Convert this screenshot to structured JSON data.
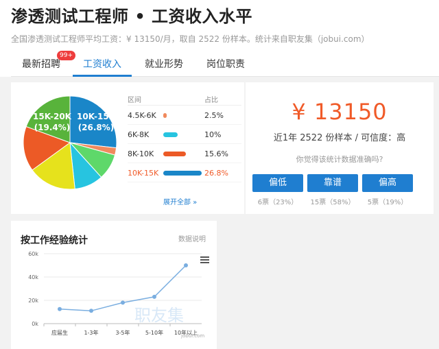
{
  "header": {
    "title": "渗透测试工程师 • 工资收入水平",
    "subtitle": "全国渗透测试工程师平均工资：¥ 13150/月，取自 2522 份样本。统计来自职友集（jobui.com）"
  },
  "tabs": [
    {
      "label": "最新招聘",
      "badge": "99+"
    },
    {
      "label": "工资收入",
      "active": true
    },
    {
      "label": "就业形势"
    },
    {
      "label": "岗位职责"
    }
  ],
  "distribution": {
    "col_range": "区间",
    "col_share": "占比",
    "rows": [
      {
        "label": "4.5K-6K",
        "percent": 2.5,
        "percent_text": "2.5%",
        "color": "#f08a5d"
      },
      {
        "label": "6K-8K",
        "percent": 10,
        "percent_text": "10%",
        "color": "#27c4e0"
      },
      {
        "label": "8K-10K",
        "percent": 15.6,
        "percent_text": "15.6%",
        "color": "#ec5a26"
      },
      {
        "label": "10K-15K",
        "percent": 26.8,
        "percent_text": "26.8%",
        "color": "#1a86c8",
        "highlight": true
      }
    ],
    "expand_label": "展开全部 »"
  },
  "pie": {
    "label_a": "15K-20K",
    "label_a_pct": "(19.4%)",
    "label_b": "10K-15K",
    "label_b_pct": "(26.8%)",
    "slices": [
      {
        "name": "10K-15K",
        "value": 26.8,
        "color": "#1a86c8"
      },
      {
        "name": "4.5K-6K",
        "value": 2.5,
        "color": "#f08a5d"
      },
      {
        "name": "slice-green-light",
        "value": 9.0,
        "color": "#5ed86a"
      },
      {
        "name": "6K-8K",
        "value": 10,
        "color": "#27c4e0"
      },
      {
        "name": "slice-yellow",
        "value": 16.7,
        "color": "#e6e21c"
      },
      {
        "name": "8K-10K",
        "value": 15.6,
        "color": "#ec5a26"
      },
      {
        "name": "15K-20K",
        "value": 19.4,
        "color": "#58b33b"
      }
    ]
  },
  "salary": {
    "amount": "¥ 13150",
    "meta": "近1年 2522 份样本 / 可信度：高",
    "vote_question": "你觉得该统计数据准确吗?",
    "votes": [
      {
        "label": "偏低",
        "count": "6票（23%）"
      },
      {
        "label": "靠谱",
        "count": "15票（58%）"
      },
      {
        "label": "偏高",
        "count": "5票（19%）"
      }
    ]
  },
  "experience": {
    "title": "按工作经验统计",
    "note": "数据说明",
    "menu_icon": "hamburger-menu-icon"
  },
  "chart_data": {
    "type": "line",
    "title": "按工作经验统计",
    "categories": [
      "应届生",
      "1-3年",
      "3-5年",
      "5-10年",
      "10年以上"
    ],
    "y_ticks": [
      "0k",
      "20k",
      "40k",
      "60k"
    ],
    "series": [
      {
        "values": [
          12500,
          11000,
          18000,
          23000,
          50000
        ],
        "color": "#7aaee0"
      }
    ],
    "ylim": [
      0,
      60000
    ],
    "grid": true
  },
  "watermark": {
    "text": "职友集",
    "site": "jobui.com"
  }
}
